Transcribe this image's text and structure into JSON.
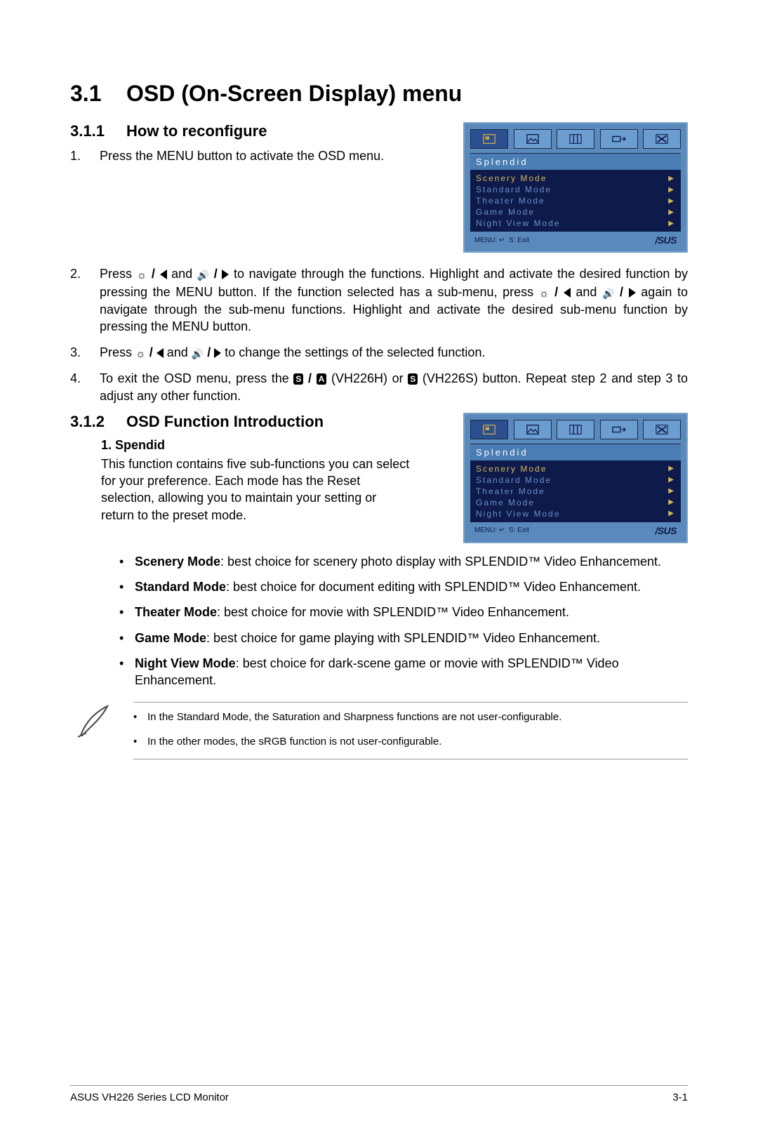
{
  "section": {
    "num": "3.1",
    "title": "OSD (On-Screen Display) menu"
  },
  "sub1": {
    "num": "3.1.1",
    "title": "How to reconfigure"
  },
  "steps": {
    "s1n": "1.",
    "s1": "Press the MENU button to activate the OSD menu.",
    "s2n": "2.",
    "s2a": "Press ",
    "s2b": " and ",
    "s2c": " to navigate through the functions. Highlight and activate the desired function by pressing the MENU button. If the function selected has a sub-menu, press ",
    "s2d": " and ",
    "s2e": " again to navigate through the sub-menu functions. Highlight and activate the desired sub-menu function by pressing the MENU button.",
    "s3n": "3.",
    "s3a": "Press ",
    "s3b": " and ",
    "s3c": " to change the settings of the selected function.",
    "s4n": "4.",
    "s4a": "To exit the OSD menu, press the ",
    "s4b": " (VH226H) or ",
    "s4c": " (VH226S) button. Repeat step 2 and step 3 to adjust any other function.",
    "chip_s": "S",
    "chip_a": "A",
    "slash": " / "
  },
  "sub2": {
    "num": "3.1.2",
    "title": "OSD Function Introduction"
  },
  "spendid": {
    "heading": "1.   Spendid",
    "desc": "This function contains five sub-functions you can select for your preference. Each mode has the Reset selection, allowing you to maintain your setting or return to the preset mode."
  },
  "modes": {
    "m1b": "Scenery Mode",
    "m1": ": best choice for scenery photo display with SPLENDID™ Video Enhancement.",
    "m2b": "Standard Mode",
    "m2": ": best choice for document editing with SPLENDID™ Video Enhancement.",
    "m3b": "Theater Mode",
    "m3": ": best choice for movie with SPLENDID™ Video Enhancement.",
    "m4b": "Game Mode",
    "m4": ": best choice for game playing with SPLENDID™ Video Enhancement.",
    "m5b": "Night View Mode",
    "m5": ": best choice for dark-scene game or movie with SPLENDID™ Video Enhancement."
  },
  "notes": {
    "n1": "In the Standard Mode, the Saturation and Sharpness functions are not user-configurable.",
    "n2": "In the other modes, the sRGB function is not user-configurable."
  },
  "osd": {
    "title": "Splendid",
    "items": [
      "Scenery Mode",
      "Standard Mode",
      "Theater Mode",
      "Game Mode",
      "Night View Mode"
    ],
    "foot_menu": "MENU:",
    "foot_enter": "↵",
    "foot_s": "S:",
    "foot_exit": "Exit",
    "brand": "/SUS"
  },
  "footer": {
    "left": "ASUS VH226 Series LCD Monitor",
    "right": "3-1"
  }
}
